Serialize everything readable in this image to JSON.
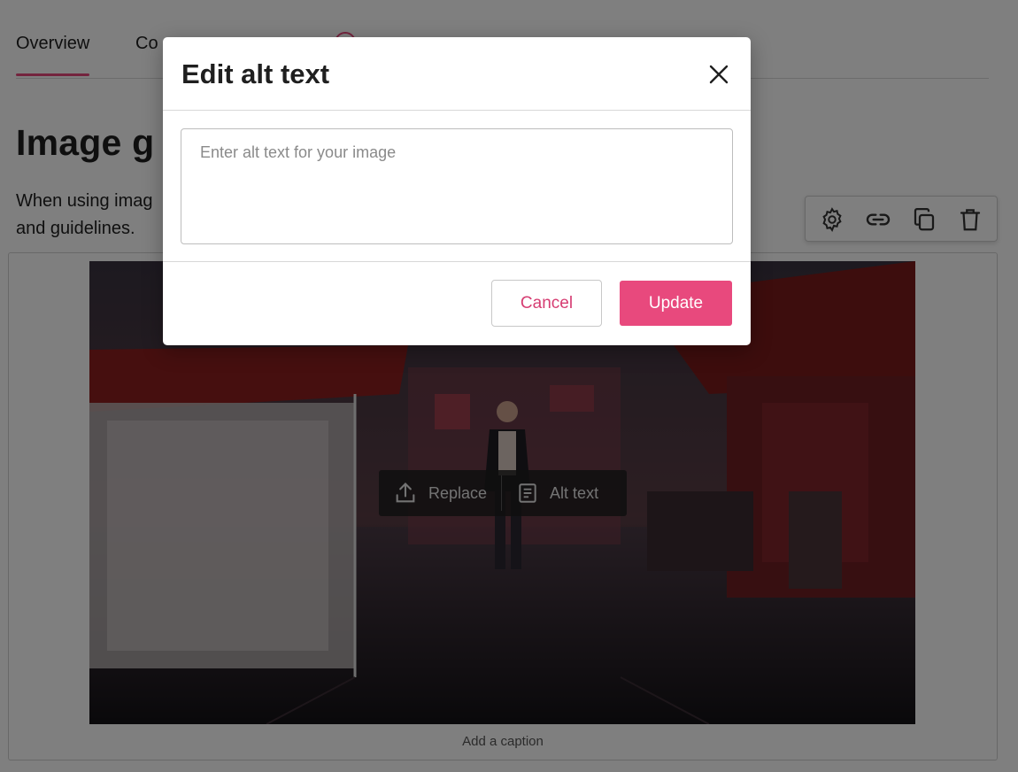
{
  "tabs": [
    {
      "label": "Overview",
      "active": true
    },
    {
      "label": "Co"
    }
  ],
  "page": {
    "title": "Image g",
    "description": "When using imag and guidelines."
  },
  "toolbar": {
    "icons": [
      "gear-icon",
      "link-icon",
      "duplicate-icon",
      "trash-icon"
    ]
  },
  "image_overlay": {
    "replace_label": "Replace",
    "alt_text_label": "Alt text"
  },
  "caption_placeholder": "Add a caption",
  "modal": {
    "title": "Edit alt text",
    "input_value": "",
    "input_placeholder": "Enter alt text for your image",
    "cancel_label": "Cancel",
    "update_label": "Update"
  },
  "colors": {
    "accent": "#e8497d",
    "scrim": "rgba(0,0,0,0.5)"
  }
}
